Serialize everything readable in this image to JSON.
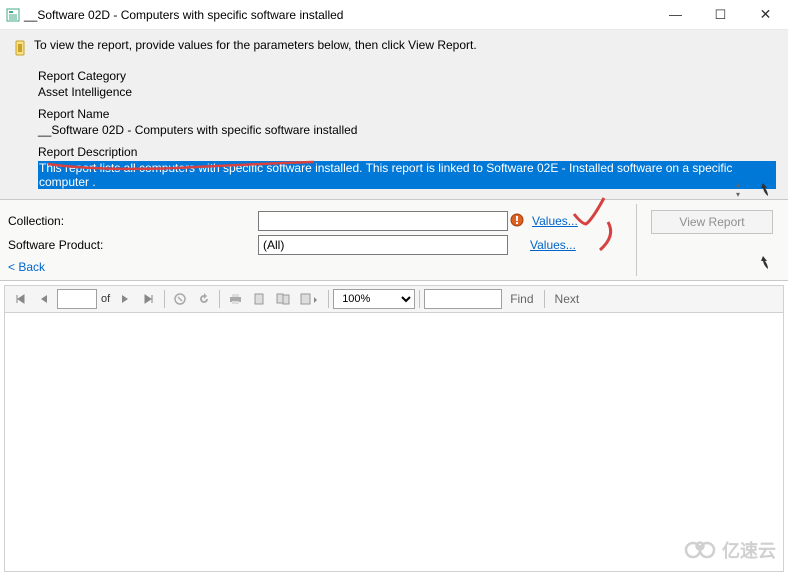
{
  "window": {
    "title": "__Software 02D - Computers with specific software installed",
    "controls": {
      "min": "—",
      "max": "☐",
      "close": "✕"
    }
  },
  "info": {
    "hint": "To view the report, provide values for the parameters below, then click View Report.",
    "category_label": "Report Category",
    "category_value": "Asset Intelligence",
    "name_label": "Report Name",
    "name_value": "__Software 02D - Computers with specific software installed",
    "desc_label": "Report Description",
    "desc_value": "This report lists all computers with specific software installed. This report is linked to Software 02E - Installed software on a specific computer ."
  },
  "params": {
    "collection_label": "Collection:",
    "collection_value": "",
    "product_label": "Software Product:",
    "product_value": "(All)",
    "values_link": "Values...",
    "back": "< Back",
    "view_report": "View Report"
  },
  "toolbar": {
    "page_input": "",
    "of_label": "of",
    "zoom": "100%",
    "find_input": "",
    "find": "Find",
    "next": "Next"
  },
  "watermark": "亿速云"
}
